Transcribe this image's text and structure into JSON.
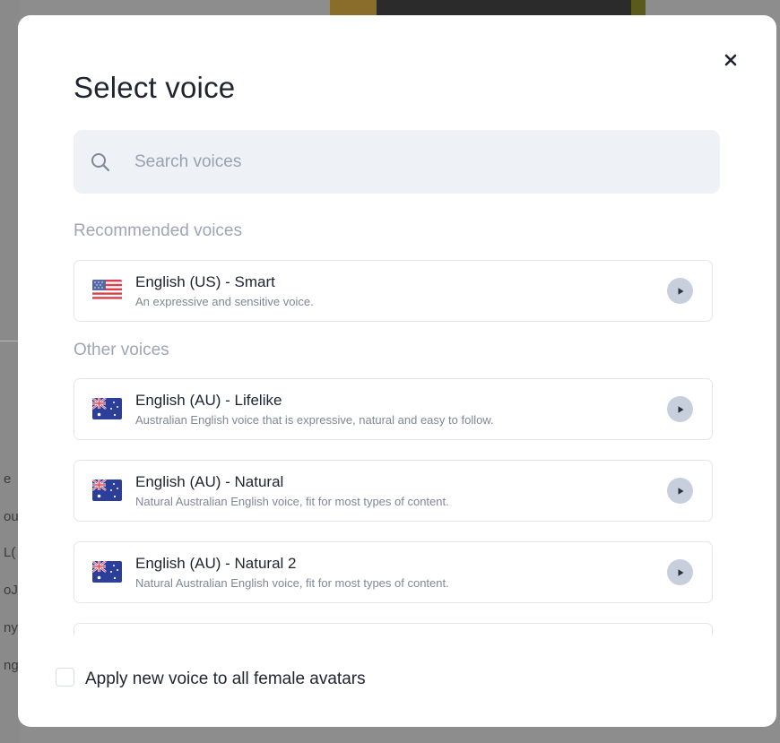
{
  "modal": {
    "title": "Select voice",
    "close_icon": "close-icon"
  },
  "search": {
    "placeholder": "Search voices",
    "value": "",
    "icon": "search-icon"
  },
  "sections": {
    "recommended": "Recommended voices",
    "other": "Other voices"
  },
  "recommended_voices": [
    {
      "name": "English (US) - Smart",
      "description": "An expressive and sensitive voice.",
      "flag": "us-flag-icon"
    }
  ],
  "other_voices": [
    {
      "name": "English (AU) - Lifelike",
      "description": "Australian English voice that is expressive, natural and easy to follow.",
      "flag": "au-flag-icon"
    },
    {
      "name": "English (AU) - Natural",
      "description": "Natural Australian English voice, fit for most types of content.",
      "flag": "au-flag-icon"
    },
    {
      "name": "English (AU) - Natural 2",
      "description": "Natural Australian English voice, fit for most types of content.",
      "flag": "au-flag-icon"
    }
  ],
  "footer": {
    "checkbox_label": "Apply new voice to all female avatars",
    "checked": false
  },
  "colors": {
    "title_text": "#1f2431",
    "muted_text": "#9ea6b3",
    "search_bg": "#eef1f6",
    "play_button": "#c7cfdd",
    "card_border": "#e3e6ec"
  }
}
